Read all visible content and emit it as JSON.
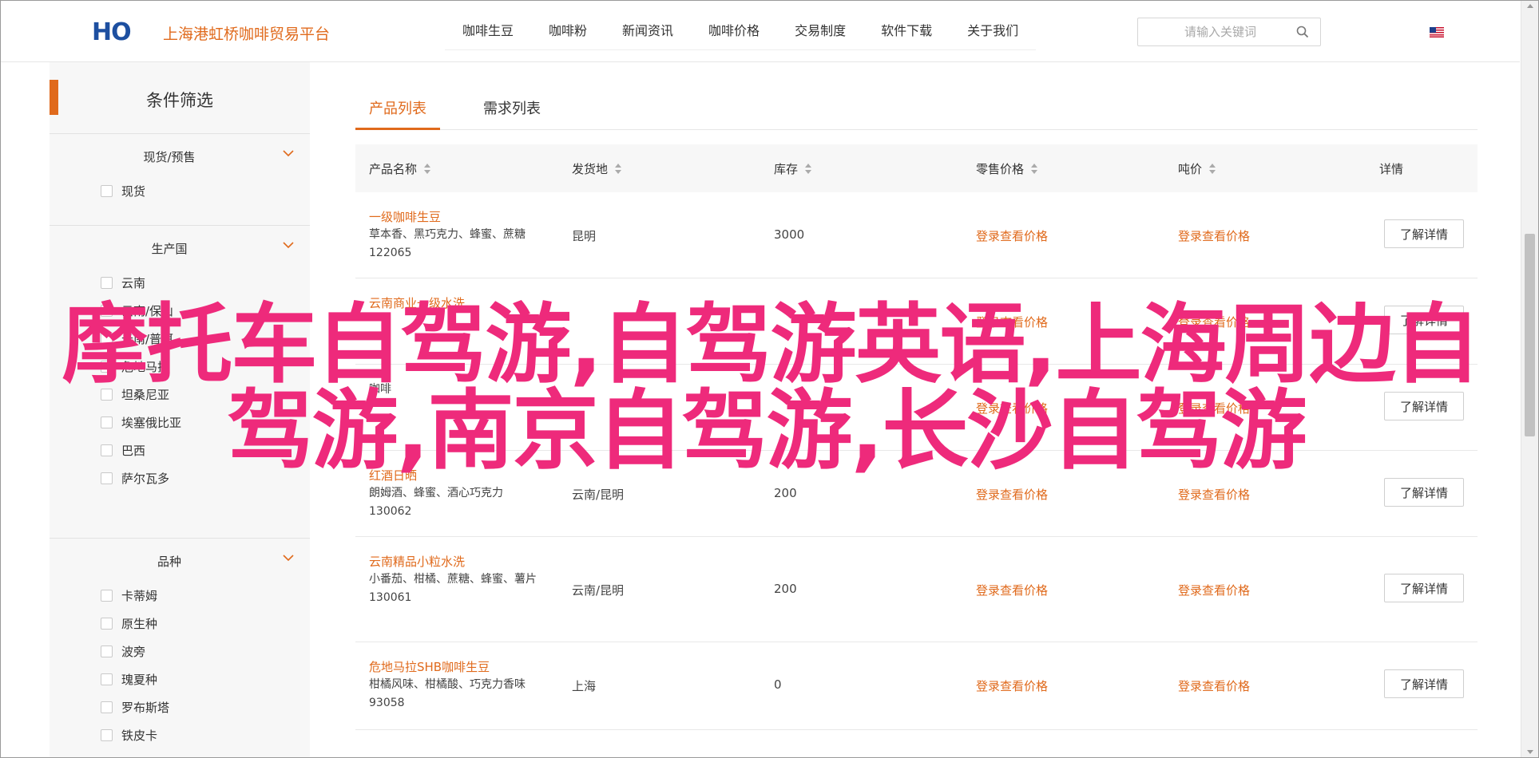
{
  "header": {
    "logo_text": "HO",
    "site_title": "上海港虹桥咖啡贸易平台",
    "nav": [
      "咖啡生豆",
      "咖啡粉",
      "新闻资讯",
      "咖啡价格",
      "交易制度",
      "软件下载",
      "关于我们"
    ],
    "search_placeholder": "请输入关键词",
    "search_icon": "search-icon",
    "flag_icon": "us-flag-icon"
  },
  "sidebar": {
    "title": "条件筛选",
    "groups": [
      {
        "title": "现货/预售",
        "options": [
          "现货"
        ]
      },
      {
        "title": "生产国",
        "options": [
          "云南",
          "云南/保山",
          "云南/普洱",
          "危地马拉",
          "坦桑尼亚",
          "埃塞俄比亚",
          "巴西",
          "萨尔瓦多"
        ]
      },
      {
        "title": "品种",
        "options": [
          "卡蒂姆",
          "原生种",
          "波旁",
          "瑰夏种",
          "罗布斯塔",
          "铁皮卡"
        ]
      }
    ]
  },
  "tabs": [
    "产品列表",
    "需求列表"
  ],
  "table": {
    "headers": [
      "产品名称",
      "发货地",
      "库存",
      "零售价格",
      "吨价",
      "详情"
    ],
    "rows": [
      {
        "name": "一级咖啡生豆",
        "desc": "草本香、黑巧克力、蜂蜜、蔗糖",
        "code": "122065",
        "origin": "昆明",
        "stock": "3000",
        "retail": "登录查看价格",
        "ton": "登录查看价格",
        "detail": "了解详情"
      },
      {
        "name": "云南商业一级水洗",
        "desc": "",
        "code": "",
        "origin": "",
        "stock": "",
        "retail": "登录查看价格",
        "ton": "登录查看价格",
        "detail": "了解详情"
      },
      {
        "name": "",
        "desc": "咖啡",
        "code": "",
        "origin": "",
        "stock": "",
        "retail": "登录查看价格",
        "ton": "登录查看价格",
        "detail": "了解详情"
      },
      {
        "name": "红酒日晒",
        "desc": "朗姆酒、蜂蜜、酒心巧克力",
        "code": "130062",
        "origin": "云南/昆明",
        "stock": "200",
        "retail": "登录查看价格",
        "ton": "登录查看价格",
        "detail": "了解详情"
      },
      {
        "name": "云南精品小粒水洗",
        "desc": "小番茄、柑橘、蔗糖、蜂蜜、薯片",
        "code": "130061",
        "origin": "云南/昆明",
        "stock": "200",
        "retail": "登录查看价格",
        "ton": "登录查看价格",
        "detail": "了解详情"
      },
      {
        "name": "危地马拉SHB咖啡生豆",
        "desc": "柑橘风味、柑橘酸、巧克力香味",
        "code": "93058",
        "origin": "上海",
        "stock": "0",
        "retail": "登录查看价格",
        "ton": "登录查看价格",
        "detail": "了解详情"
      }
    ]
  },
  "overlay": {
    "line1": "摩托车自驾游,自驾游英语,上海周边自",
    "line2": "驾游,南京自驾游,长沙自驾游"
  },
  "colors": {
    "accent": "#e06a1c",
    "overlay": "#ee2a7b",
    "brand": "#1d4fa0"
  }
}
